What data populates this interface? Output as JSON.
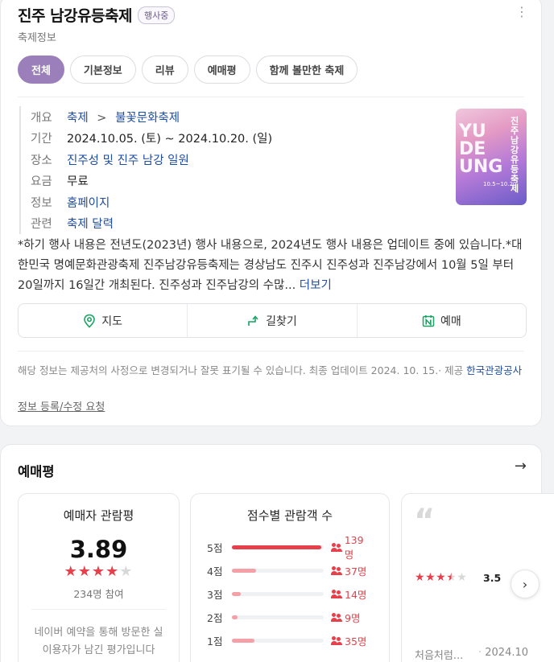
{
  "header": {
    "title": "진주 남강유등축제",
    "badge": "행사중",
    "subtitle": "축제정보",
    "more_icon": "more-vertical-icon"
  },
  "tabs": [
    {
      "label": "전체",
      "active": true
    },
    {
      "label": "기본정보",
      "active": false
    },
    {
      "label": "리뷰",
      "active": false
    },
    {
      "label": "예매평",
      "active": false
    },
    {
      "label": "함께 볼만한 축제",
      "active": false
    }
  ],
  "info": {
    "overview": {
      "key": "개요",
      "category": "축제",
      "separator": ">",
      "subcategory": "불꽃문화축제"
    },
    "period": {
      "key": "기간",
      "value": "2024.10.05. (토) ~  2024.10.20. (일)"
    },
    "place": {
      "key": "장소",
      "value": "진주성 및 진주 남강 일원"
    },
    "fee": {
      "key": "요금",
      "value": "무료"
    },
    "homepage": {
      "key": "정보",
      "value": "홈페이지"
    },
    "related": {
      "key": "관련",
      "value": "축제 달력"
    }
  },
  "poster": {
    "big_text": [
      "YU",
      "DE",
      "UNG"
    ],
    "korean_text": "진주남강유등축제",
    "dates_text": "10.5~10.20"
  },
  "description": {
    "text": "*하기 행사 내용은 전년도(2023년) 행사 내용으로, 2024년도 행사 내용은 업데이트 중에 있습니다.*대한민국 명예문화관광축제 진주남강유등축제는 경상남도 진주시 진주성과 진주남강에서 10월 5일 부터 20일까지 16일간 개최된다. 진주성과 진주남강의 수많...",
    "more_label": "더보기"
  },
  "actions": [
    {
      "label": "지도",
      "icon": "map-pin-icon"
    },
    {
      "label": "길찾기",
      "icon": "directions-icon"
    },
    {
      "label": "예매",
      "icon": "naver-booking-icon"
    }
  ],
  "notice": {
    "text": "해당 정보는 제공처의 사정으로 변경되거나 잘못 표기될 수 있습니다. 최종 업데이트 2024. 10. 15.· 제공",
    "provider": "한국관광공사",
    "edit_label": "정보 등록/수정 요청"
  },
  "review_section": {
    "title": "예매평",
    "arrow_icon": "arrow-right-icon",
    "summary": {
      "title": "예매자 관람평",
      "score": "3.89",
      "stars_filled": 4,
      "stars_total": 5,
      "participants": "234명 참여",
      "note": "네이버 예약을 통해 방문한 실 이용자가 남긴 평가입니다"
    },
    "distribution": {
      "title": "점수별 관람객 수",
      "rows": [
        {
          "label": "5점",
          "count": "139명",
          "value": 139,
          "color": "#e8404a"
        },
        {
          "label": "4점",
          "count": "37명",
          "value": 37,
          "color": "#f4a0a6"
        },
        {
          "label": "3점",
          "count": "14명",
          "value": 14,
          "color": "#f4a0a6"
        },
        {
          "label": "2점",
          "count": "9명",
          "value": 9,
          "color": "#f4a0a6"
        },
        {
          "label": "1점",
          "count": "35명",
          "value": 35,
          "color": "#f4a0a6"
        }
      ],
      "max": 234
    },
    "review_card": {
      "quote_icon": "quote-icon",
      "stars_value": 3.5,
      "score": "3.5",
      "author": "처음처럼...",
      "date": "2024.10"
    },
    "next_icon": "chevron-right-icon"
  }
}
